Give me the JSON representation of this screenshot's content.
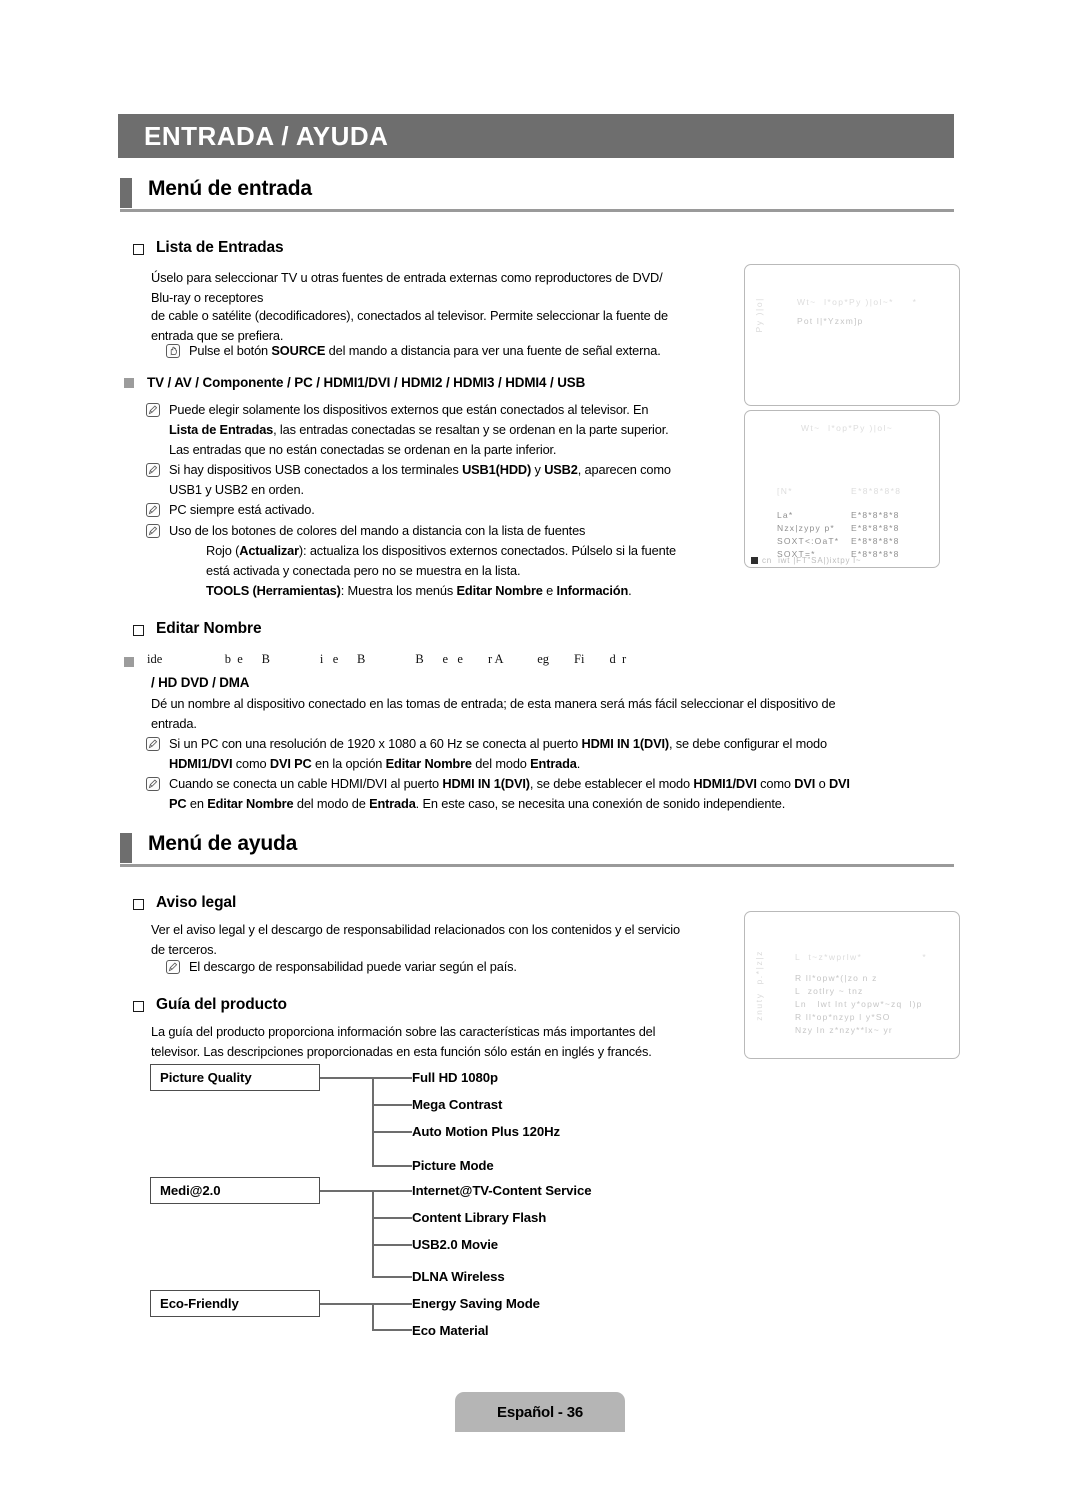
{
  "header": {
    "title": "ENTRADA / AYUDA",
    "banner_color": "#6e6e6e"
  },
  "sections": [
    {
      "heading": "Menú de entrada",
      "items": [
        {
          "title": "Lista de Entradas",
          "paragraphs": [
            "Úselo para seleccionar TV u otras fuentes de entrada externas como reproductores de DVD/",
            "Blu-ray o receptores",
            "de cable o satélite (decodificadores), conectados al televisor. Permite seleccionar la fuente de",
            "entrada que se prefiera."
          ],
          "hand_note": {
            "pre": "Pulse el botón ",
            "bold": "SOURCE",
            "post": " del mando a distancia para ver una fuente de señal externa."
          },
          "square_item": "TV / AV / Componente / PC / HDMI1/DVI / HDMI2 / HDMI3 / HDMI4 / USB",
          "notes": [
            {
              "lines": [
                [
                  {
                    "t": "Puede elegir solamente los dispositivos externos que están conectados al televisor. En",
                    "b": false
                  }
                ],
                [
                  {
                    "t": "Lista de Entradas",
                    "b": true
                  },
                  {
                    "t": ", las entradas conectadas se resaltan y se ordenan en la parte superior.",
                    "b": false
                  }
                ],
                [
                  {
                    "t": "Las entradas que no están conectadas se ordenan en la parte inferior.",
                    "b": false
                  }
                ]
              ]
            },
            {
              "lines": [
                [
                  {
                    "t": "Si hay dispositivos USB conectados a los terminales ",
                    "b": false
                  },
                  {
                    "t": "USB1(HDD)",
                    "b": true
                  },
                  {
                    "t": " y ",
                    "b": false
                  },
                  {
                    "t": "USB2",
                    "b": true
                  },
                  {
                    "t": ", aparecen como",
                    "b": false
                  }
                ],
                [
                  {
                    "t": "USB1 y USB2 en orden.",
                    "b": false
                  }
                ]
              ]
            },
            {
              "lines": [
                [
                  {
                    "t": "PC siempre está activado.",
                    "b": false
                  }
                ]
              ]
            },
            {
              "lines": [
                [
                  {
                    "t": "Uso de los botones de colores del mando a distancia con la lista de fuentes",
                    "b": false
                  }
                ]
              ]
            }
          ],
          "color_button_lines": [
            [
              {
                "t": "Rojo (",
                "b": false
              },
              {
                "t": "Actualizar",
                "b": true
              },
              {
                "t": "): actualiza los dispositivos externos conectados. Púlselo si la fuente",
                "b": false
              }
            ],
            [
              {
                "t": "está activada y conectada pero no se muestra en la lista.",
                "b": false
              }
            ],
            [
              {
                "t": "TOOLS",
                "b": true
              },
              {
                "t": " (Herramientas)",
                "b": true
              },
              {
                "t": ": Muestra los menús ",
                "b": false
              },
              {
                "t": "Editar Nombre",
                "b": true
              },
              {
                "t": " e ",
                "b": false
              },
              {
                "t": "Información",
                "b": true
              },
              {
                "t": ".",
                "b": false
              }
            ]
          ]
        },
        {
          "title": "Editar Nombre",
          "garbled_line": "ide                    b  e      B                i   e      B                B      e   e        r A           eg        Fi        d  r",
          "garbled_line2": "/ HD DVD / DMA",
          "paragraphs": [
            "Dé un nombre al dispositivo conectado en las tomas de entrada; de esta manera será más fácil seleccionar el dispositivo de",
            "entrada."
          ],
          "notes": [
            {
              "lines": [
                [
                  {
                    "t": "Si un PC con una resolución de 1920 x 1080 a 60 Hz se conecta al puerto ",
                    "b": false
                  },
                  {
                    "t": "HDMI IN 1(DVI)",
                    "b": true
                  },
                  {
                    "t": ", se debe configurar el modo",
                    "b": false
                  }
                ],
                [
                  {
                    "t": "HDMI1/DVI",
                    "b": true
                  },
                  {
                    "t": " como ",
                    "b": false
                  },
                  {
                    "t": "DVI PC",
                    "b": true
                  },
                  {
                    "t": " en la opción ",
                    "b": false
                  },
                  {
                    "t": "Editar Nombre",
                    "b": true
                  },
                  {
                    "t": " del modo ",
                    "b": false
                  },
                  {
                    "t": "Entrada",
                    "b": true
                  },
                  {
                    "t": ".",
                    "b": false
                  }
                ]
              ]
            },
            {
              "lines": [
                [
                  {
                    "t": "Cuando se conecta un cable HDMI/DVI al puerto ",
                    "b": false
                  },
                  {
                    "t": "HDMI IN 1(DVI)",
                    "b": true
                  },
                  {
                    "t": ", se debe establecer el modo ",
                    "b": false
                  },
                  {
                    "t": "HDMI1/DVI",
                    "b": true
                  },
                  {
                    "t": " como ",
                    "b": false
                  },
                  {
                    "t": "DVI",
                    "b": true
                  },
                  {
                    "t": " o ",
                    "b": false
                  },
                  {
                    "t": "DVI",
                    "b": true
                  }
                ],
                [
                  {
                    "t": "PC",
                    "b": true
                  },
                  {
                    "t": " en ",
                    "b": false
                  },
                  {
                    "t": "Editar Nombre",
                    "b": true
                  },
                  {
                    "t": " del modo de ",
                    "b": false
                  },
                  {
                    "t": "Entrada",
                    "b": true
                  },
                  {
                    "t": ". En este caso, se necesita una conexión de sonido independiente.",
                    "b": false
                  }
                ]
              ]
            }
          ]
        }
      ]
    },
    {
      "heading": "Menú de ayuda",
      "items": [
        {
          "title": "Aviso legal",
          "paragraphs": [
            "Ver el aviso legal y el descargo de responsabilidad relacionados con los contenidos y el servicio",
            "de terceros."
          ],
          "notes": [
            {
              "lines": [
                [
                  {
                    "t": "El descargo de responsabilidad puede variar según el país.",
                    "b": false
                  }
                ]
              ]
            }
          ]
        },
        {
          "title": "Guía del producto",
          "paragraphs": [
            "La guía del producto proporciona información sobre las características más importantes del",
            "televisor. Las descripciones proporcionadas en esta función sólo están en inglés y francés."
          ]
        }
      ]
    }
  ],
  "osd_screens": [
    {
      "name": "lista-de-entradas-osd",
      "vertical_label": "Py )|o|",
      "lines": [
        {
          "text": "Wt~  l*op*Py )|ol~*     *",
          "tone": "faint"
        },
        {
          "text": "Pot l|*Yzxm]p",
          "tone": "mid"
        }
      ]
    },
    {
      "name": "entradas-detalle-osd",
      "title": "Wt~  l*op*Py )|ol~",
      "rows": [
        {
          "left": "[N*",
          "right": "E*8*8*8*8",
          "tone": "faint"
        },
        {
          "left": "La*",
          "right": "E*8*8*8*8",
          "tone": "dark"
        },
        {
          "left": "Nzx|zypy p*",
          "right": "E*8*8*8*8",
          "tone": "dark"
        },
        {
          "left": "SOXT<:OaT*",
          "right": "E*8*8*8*8",
          "tone": "dark"
        },
        {
          "left": "SOXT=*",
          "right": "E*8*8*8*8",
          "tone": "dark"
        }
      ],
      "bottom_bar": "cn  iwt |FT\"SA|)ixtpy l~"
    },
    {
      "name": "guia-del-producto-osd",
      "vertical_label": "znuty  p.*|z|z",
      "lines": [
        {
          "text": "L  t~z*wprlw*                *              #",
          "tone": "faint"
        },
        {
          "text": "R ll*opw*(|zo n z",
          "tone": "mid"
        },
        {
          "text": "L  zotlry ~ tnz",
          "tone": "mid"
        },
        {
          "text": "Ln   lwt lnt y*opw*~zq  l)p",
          "tone": "mid"
        },
        {
          "text": "R ll*op*nzyp l y*SO",
          "tone": "mid"
        },
        {
          "text": "Nzy ln z*nzy**lx~ yr",
          "tone": "mid"
        }
      ]
    }
  ],
  "tree": {
    "groups": [
      {
        "label": "Picture Quality",
        "leaves": [
          "Full HD 1080p",
          "Mega Contrast",
          "Auto Motion Plus 120Hz",
          "Picture Mode"
        ]
      },
      {
        "label": "Medi@2.0",
        "leaves": [
          "Internet@TV-Content Service",
          "Content Library Flash",
          "USB2.0 Movie",
          "DLNA Wireless"
        ]
      },
      {
        "label": "Eco-Friendly",
        "leaves": [
          "Energy Saving Mode",
          "Eco Material"
        ]
      }
    ]
  },
  "footer": {
    "label": "Español - 36"
  }
}
